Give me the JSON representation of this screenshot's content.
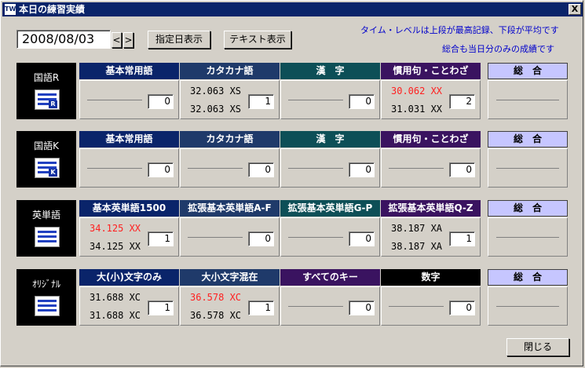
{
  "window": {
    "title": "本日の練習実績",
    "app_icon": "TW",
    "close_label": "X"
  },
  "toolbar": {
    "date_value": "2008/08/03",
    "prev_label": "<",
    "next_label": ">",
    "specified_date_label": "指定日表示",
    "text_view_label": "テキスト表示"
  },
  "notes": {
    "line1": "タイム・レベルは上段が最高記録、下段が平均です",
    "line2": "総合も当日分のみの成績です"
  },
  "summary_label": "総　合",
  "close_button_label": "閉じる",
  "colors": {
    "blue_header": "#0a246a",
    "navy_header": "#1f3a6a",
    "teal_header": "#0d4f57",
    "purple_header": "#3a1360",
    "black_header": "#000000",
    "summary_header": "#c6c6ff",
    "best_red": "#ff2020",
    "note_blue": "#0000cc"
  },
  "sections": [
    {
      "label": "国語R",
      "icon": "kokugo-r-icon",
      "icon_letter": "R",
      "categories": [
        {
          "name": "基本常用語",
          "color": "#0a246a",
          "best": "",
          "avg": "",
          "count": "0",
          "best_red": false
        },
        {
          "name": "カタカナ語",
          "color": "#1f3a6a",
          "best": "32.063 XS",
          "avg": "32.063 XS",
          "count": "1",
          "best_red": false
        },
        {
          "name": "漢　字",
          "color": "#0d4f57",
          "best": "",
          "avg": "",
          "count": "0",
          "best_red": false
        },
        {
          "name": "慣用句・ことわざ",
          "color": "#3a1360",
          "best": "30.062 XX",
          "avg": "31.031 XX",
          "count": "2",
          "best_red": true
        }
      ]
    },
    {
      "label": "国語K",
      "icon": "kokugo-k-icon",
      "icon_letter": "K",
      "categories": [
        {
          "name": "基本常用語",
          "color": "#0a246a",
          "best": "",
          "avg": "",
          "count": "0",
          "best_red": false
        },
        {
          "name": "カタカナ語",
          "color": "#1f3a6a",
          "best": "",
          "avg": "",
          "count": "0",
          "best_red": false
        },
        {
          "name": "漢　字",
          "color": "#0d4f57",
          "best": "",
          "avg": "",
          "count": "0",
          "best_red": false
        },
        {
          "name": "慣用句・ことわざ",
          "color": "#3a1360",
          "best": "",
          "avg": "",
          "count": "0",
          "best_red": false
        }
      ]
    },
    {
      "label": "英単語",
      "icon": "english-words-icon",
      "icon_letter": "",
      "categories": [
        {
          "name": "基本英単語1500",
          "color": "#0a246a",
          "best": "34.125 XX",
          "avg": "34.125 XX",
          "count": "1",
          "best_red": true
        },
        {
          "name": "拡張基本英単語A-F",
          "color": "#1f3a6a",
          "best": "",
          "avg": "",
          "count": "0",
          "best_red": false
        },
        {
          "name": "拡張基本英単語G-P",
          "color": "#0d4f57",
          "best": "",
          "avg": "",
          "count": "0",
          "best_red": false
        },
        {
          "name": "拡張基本英単語Q-Z",
          "color": "#3a1360",
          "best": "38.187 XA",
          "avg": "38.187 XA",
          "count": "1",
          "best_red": false
        }
      ]
    },
    {
      "label": "ｵﾘｼﾞﾅﾙ",
      "icon": "original-icon",
      "icon_letter": "",
      "categories": [
        {
          "name": "大(小)文字のみ",
          "color": "#0a246a",
          "best": "31.688 XC",
          "avg": "31.688 XC",
          "count": "1",
          "best_red": false
        },
        {
          "name": "大小文字混在",
          "color": "#1f3a6a",
          "best": "36.578 XC",
          "avg": "36.578 XC",
          "count": "1",
          "best_red": true
        },
        {
          "name": "すべてのキー",
          "color": "#3a1360",
          "best": "",
          "avg": "",
          "count": "0",
          "best_red": false
        },
        {
          "name": "数字",
          "color": "#000000",
          "best": "",
          "avg": "",
          "count": "0",
          "best_red": false
        }
      ]
    }
  ]
}
